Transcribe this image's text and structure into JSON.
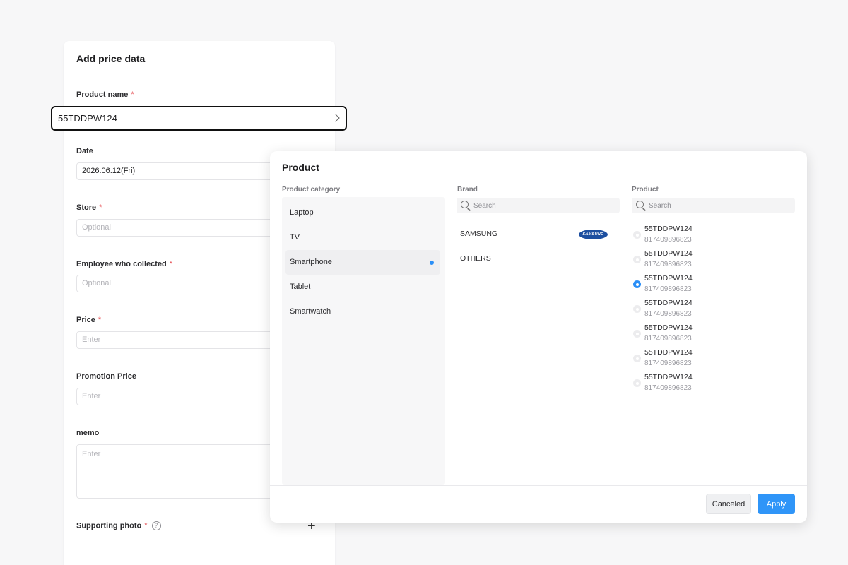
{
  "form": {
    "title": "Add price data",
    "product_name": {
      "label": "Product name",
      "required": "*",
      "value": "55TDDPW124"
    },
    "date": {
      "label": "Date",
      "value": "2026.06.12(Fri)"
    },
    "store": {
      "label": "Store",
      "required": "*",
      "placeholder": "Optional"
    },
    "employee": {
      "label": "Employee who collected",
      "required": "*",
      "placeholder": "Optional"
    },
    "price": {
      "label": "Price",
      "required": "*",
      "placeholder": "Enter"
    },
    "promotion_price": {
      "label": "Promotion Price",
      "placeholder": "Enter"
    },
    "memo": {
      "label": "memo",
      "placeholder": "Enter"
    },
    "supporting_photo": {
      "label": "Supporting photo",
      "required": "*",
      "help": "?",
      "add": "+"
    }
  },
  "modal": {
    "title": "Product",
    "category_label": "Product category",
    "brand_label": "Brand",
    "product_label": "Product",
    "categories": [
      "Laptop",
      "TV",
      "Smartphone",
      "Tablet",
      "Smartwatch"
    ],
    "selected_category": "Smartphone",
    "brand_search_placeholder": "Search",
    "product_search_placeholder": "Search",
    "brands": [
      "SAMSUNG",
      "OTHERS"
    ],
    "brand_logo_text": "SAMSUNG",
    "products": [
      {
        "name": "55TDDPW124",
        "code": "817409896823",
        "checked": false
      },
      {
        "name": "55TDDPW124",
        "code": "817409896823",
        "checked": false
      },
      {
        "name": "55TDDPW124",
        "code": "817409896823",
        "checked": true
      },
      {
        "name": "55TDDPW124",
        "code": "817409896823",
        "checked": false
      },
      {
        "name": "55TDDPW124",
        "code": "817409896823",
        "checked": false
      },
      {
        "name": "55TDDPW124",
        "code": "817409896823",
        "checked": false
      },
      {
        "name": "55TDDPW124",
        "code": "817409896823",
        "checked": false
      }
    ],
    "cancel_label": "Canceled",
    "apply_label": "Apply"
  },
  "colors": {
    "accent": "#2f95f8",
    "required": "#e5484d",
    "samsung_blue": "#1d4fa0"
  }
}
